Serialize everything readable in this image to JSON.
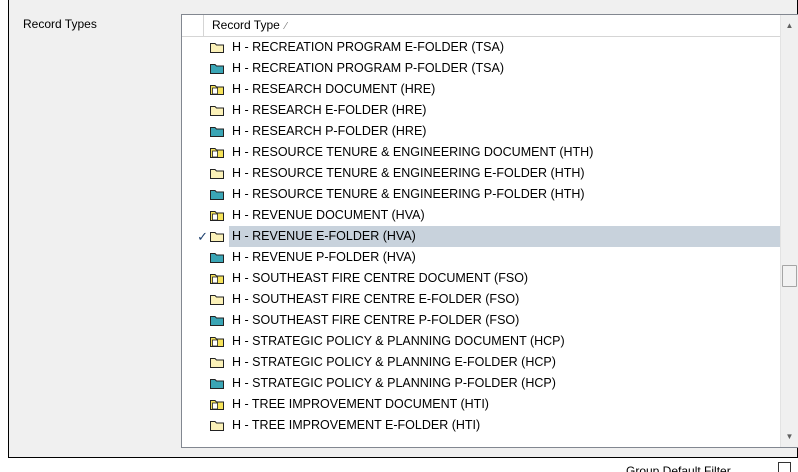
{
  "field_label": "Record Types",
  "list": {
    "column_header": "Record Type",
    "sort_glyph": "⁄",
    "rows": [
      {
        "label": "H - RECREATION PROGRAM E-FOLDER (TSA)",
        "kind": "e-folder"
      },
      {
        "label": "H - RECREATION PROGRAM P-FOLDER (TSA)",
        "kind": "p-folder"
      },
      {
        "label": "H - RESEARCH DOCUMENT (HRE)",
        "kind": "document"
      },
      {
        "label": "H - RESEARCH E-FOLDER (HRE)",
        "kind": "e-folder"
      },
      {
        "label": "H - RESEARCH P-FOLDER (HRE)",
        "kind": "p-folder"
      },
      {
        "label": "H - RESOURCE TENURE & ENGINEERING DOCUMENT (HTH)",
        "kind": "document"
      },
      {
        "label": "H - RESOURCE TENURE & ENGINEERING E-FOLDER (HTH)",
        "kind": "e-folder"
      },
      {
        "label": "H - RESOURCE TENURE & ENGINEERING P-FOLDER (HTH)",
        "kind": "p-folder"
      },
      {
        "label": "H - REVENUE DOCUMENT (HVA)",
        "kind": "document"
      },
      {
        "label": "H - REVENUE E-FOLDER (HVA)",
        "kind": "e-folder",
        "checked": true,
        "selected": true
      },
      {
        "label": "H - REVENUE P-FOLDER (HVA)",
        "kind": "p-folder"
      },
      {
        "label": "H - SOUTHEAST FIRE CENTRE DOCUMENT (FSO)",
        "kind": "document"
      },
      {
        "label": "H - SOUTHEAST FIRE CENTRE E-FOLDER (FSO)",
        "kind": "e-folder"
      },
      {
        "label": "H - SOUTHEAST FIRE CENTRE P-FOLDER (FSO)",
        "kind": "p-folder"
      },
      {
        "label": "H - STRATEGIC POLICY & PLANNING DOCUMENT (HCP)",
        "kind": "document"
      },
      {
        "label": "H - STRATEGIC POLICY & PLANNING E-FOLDER (HCP)",
        "kind": "e-folder"
      },
      {
        "label": "H - STRATEGIC POLICY & PLANNING P-FOLDER (HCP)",
        "kind": "p-folder"
      },
      {
        "label": "H - TREE IMPROVEMENT DOCUMENT (HTI)",
        "kind": "document"
      },
      {
        "label": "H - TREE IMPROVEMENT E-FOLDER (HTI)",
        "kind": "e-folder"
      }
    ],
    "check_glyph": "✓",
    "icon_names": {
      "document": "yellow-document-folder-icon",
      "e-folder": "light-yellow-e-folder-icon",
      "p-folder": "teal-p-folder-icon"
    },
    "icon_colors": {
      "document": "#f6e35a",
      "e-folder": "#fbf1b8",
      "p-folder": "#3aa5b5"
    },
    "selection_color": "#c8d2dc"
  },
  "bottom_label": "Group Default Filter"
}
